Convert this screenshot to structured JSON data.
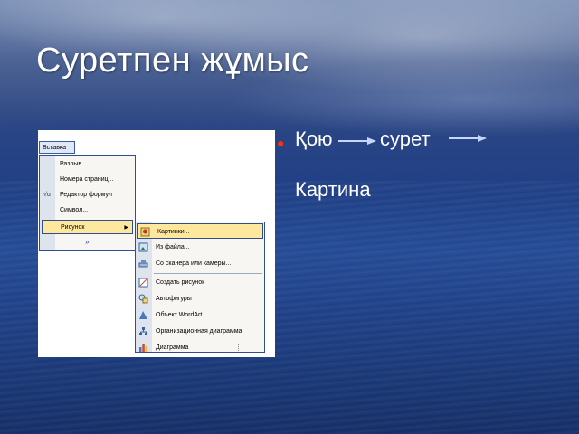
{
  "slide": {
    "title": "Суретпен жұмыс",
    "bullets": {
      "word1": "Қою",
      "word2": "сурет",
      "word3": "Картина"
    }
  },
  "colors": {
    "bullet": "#ff3300",
    "menu_highlight": "#ffe79e",
    "menu_border": "#2f4f8f",
    "arrow": "#c7d6ff"
  },
  "screenshot": {
    "menu_title": "Вставка",
    "menu_items": [
      {
        "label": "Разрыв...",
        "icon": ""
      },
      {
        "label": "Номера страниц...",
        "icon": ""
      },
      {
        "label": "Редактор формул",
        "icon": "formula-icon"
      },
      {
        "label": "Символ...",
        "icon": ""
      },
      {
        "label": "Рисунок",
        "icon": "",
        "submenu": true,
        "highlighted": true
      }
    ],
    "expand_glyph": "»",
    "submenu_items": [
      {
        "label": "Картинки...",
        "icon": "clipart-icon",
        "highlighted": true
      },
      {
        "label": "Из файла...",
        "icon": "picture-file-icon"
      },
      {
        "label": "Со сканера или камеры...",
        "icon": "scanner-icon"
      },
      {
        "label": "Создать рисунок",
        "icon": "new-drawing-icon"
      },
      {
        "label": "Автофигуры",
        "icon": "autoshapes-icon"
      },
      {
        "label": "Объект WordArt...",
        "icon": "wordart-icon"
      },
      {
        "label": "Организационная диаграмма",
        "icon": "org-chart-icon"
      },
      {
        "label": "Диаграмма",
        "icon": "chart-icon"
      }
    ]
  }
}
